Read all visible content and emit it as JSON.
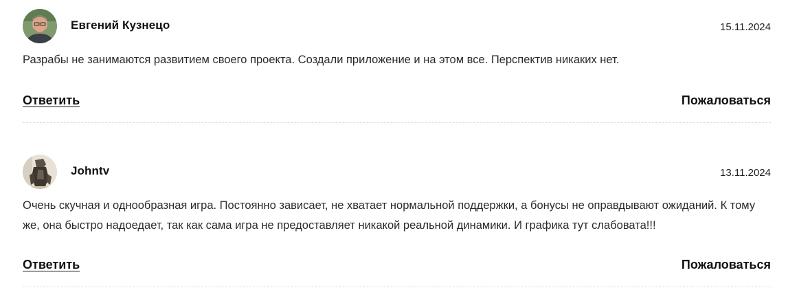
{
  "comments": [
    {
      "author": "Евгений Кузнецо",
      "date": "15.11.2024",
      "text": "Разрабы не занимаются развитием своего проекта. Создали приложение и на этом все. Перспектив никаких нет.",
      "reply_label": "Ответить",
      "report_label": "Пожаловаться",
      "avatar_icon": "user-photo-avatar"
    },
    {
      "author": "Johntv",
      "date": "13.11.2024",
      "text": "Очень скучная и однообразная игра. Постоянно зависает, не хватает нормальной поддержки, а бонусы не оправдывают ожиданий. К тому же, она быстро надоедает, так как сама игра не предоставляет никакой реальной динамики. И графика тут слабовата!!!",
      "reply_label": "Ответить",
      "report_label": "Пожаловаться",
      "avatar_icon": "user-photo-avatar"
    }
  ]
}
